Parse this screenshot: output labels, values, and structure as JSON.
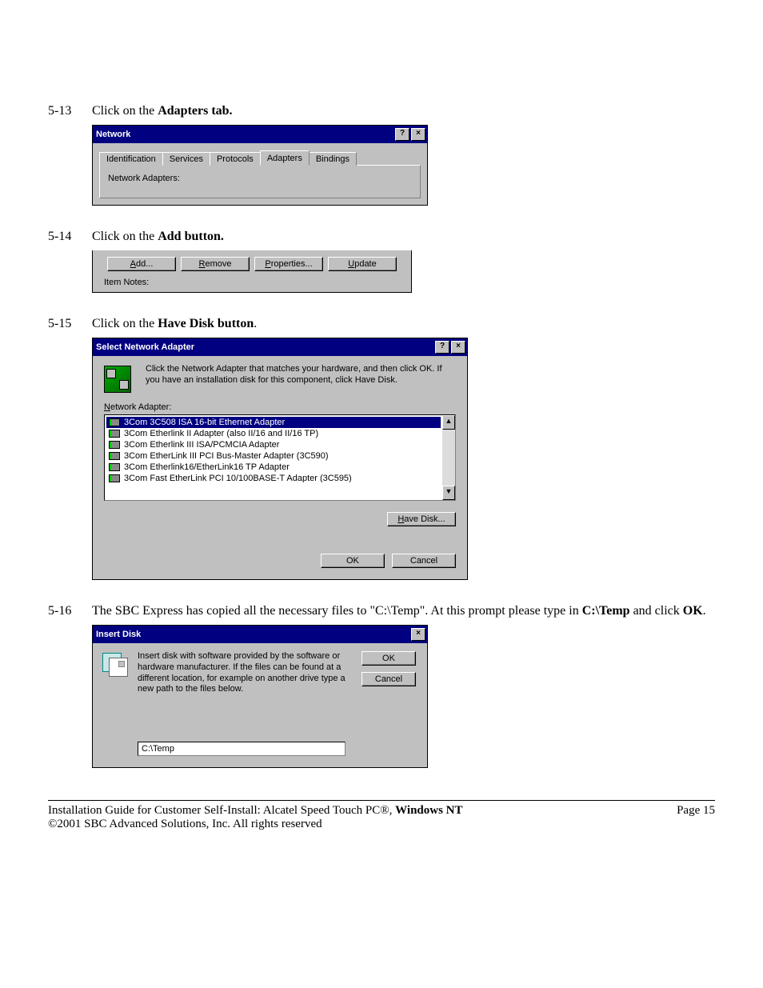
{
  "steps": {
    "s13": {
      "num": "5-13",
      "pre": "Click on the ",
      "bold": "Adapters tab."
    },
    "s14": {
      "num": "5-14",
      "pre": "Click on the ",
      "bold": "Add button."
    },
    "s15": {
      "num": "5-15",
      "pre": "Click on the ",
      "bold": "Have Disk button",
      "post": "."
    },
    "s16": {
      "num": "5-16",
      "part1": "The SBC Express has copied all the necessary files to  \"C:\\Temp\".  At this prompt please type in ",
      "bold1": "C:\\Temp",
      "mid": " and click ",
      "bold2": "OK",
      "post": "."
    }
  },
  "networkWin": {
    "title": "Network",
    "tabs": [
      "Identification",
      "Services",
      "Protocols",
      "Adapters",
      "Bindings"
    ],
    "activeTab": 3,
    "bodyLabel": "Network Adapters:"
  },
  "addRow": {
    "buttons": {
      "add": {
        "u": "A",
        "rest": "dd..."
      },
      "remove": {
        "u": "R",
        "rest": "emove"
      },
      "props": {
        "u": "P",
        "rest": "roperties..."
      },
      "update": {
        "u": "U",
        "rest": "pdate"
      }
    },
    "itemNotes": "Item Notes:"
  },
  "selectAdapter": {
    "title": "Select Network Adapter",
    "message": "Click the Network Adapter that matches your hardware, and then click OK.  If you have an installation disk for this component, click Have Disk.",
    "listLabel": {
      "u": "N",
      "rest": "etwork Adapter:"
    },
    "items": [
      "3Com 3C508 ISA 16-bit Ethernet Adapter",
      "3Com Etherlink II Adapter (also II/16 and II/16 TP)",
      "3Com Etherlink III ISA/PCMCIA Adapter",
      "3Com EtherLink III PCI Bus-Master Adapter (3C590)",
      "3Com Etherlink16/EtherLink16 TP Adapter",
      "3Com Fast EtherLink PCI 10/100BASE-T Adapter (3C595)"
    ],
    "selectedIndex": 0,
    "haveDisk": {
      "u": "H",
      "rest": "ave Disk..."
    },
    "ok": "OK",
    "cancel": "Cancel"
  },
  "insertDisk": {
    "title": "Insert Disk",
    "message": "Insert disk with software provided by the software or hardware manufacturer.  If the files can be found at a different location, for example on another drive type a new path to the files below.",
    "inputValue": "C:\\Temp",
    "ok": "OK",
    "cancel": "Cancel"
  },
  "footer": {
    "line1a": "Installation Guide for Customer Self-Install: Alcatel Speed Touch PC®, ",
    "line1b": "Windows NT",
    "line2": "©2001 SBC Advanced Solutions, Inc.  All rights reserved",
    "page": "Page 15"
  }
}
